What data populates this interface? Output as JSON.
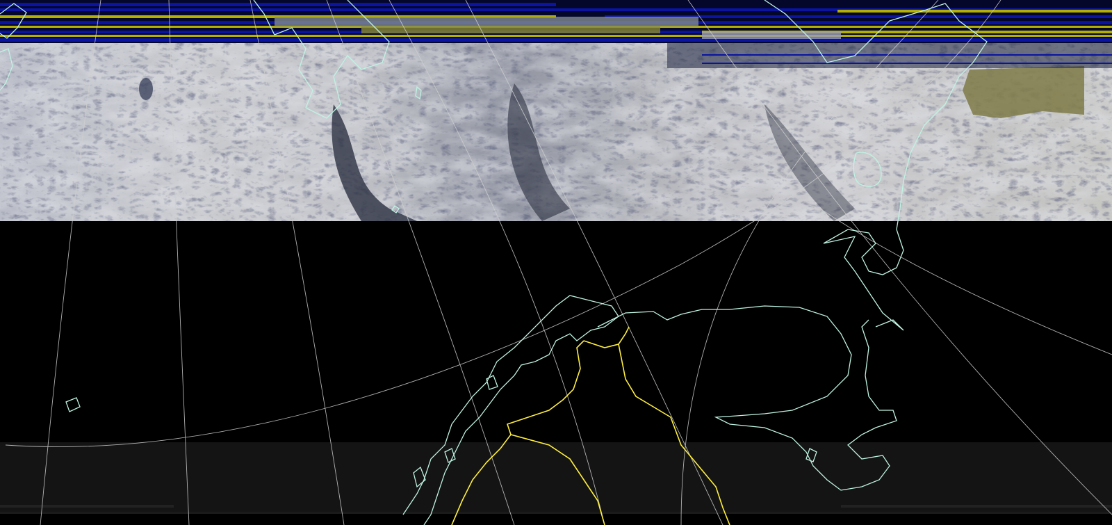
{
  "image": {
    "kind": "satellite weather image with map overlay",
    "text_visible": false
  },
  "colors": {
    "background": "#000000",
    "coastline": "#bff3e3",
    "border": "#ffef40",
    "graticule": "#cfcfcf",
    "cloud_light": "#c7c8cc",
    "cloud_mid": "#9a9ca6",
    "cloud_dark": "#2c2f3d",
    "noise_blue": "#0a14a0",
    "noise_yellow": "#b4b000",
    "land_olive": "#7f7a48"
  },
  "layers": [
    {
      "id": "satellite-imagery",
      "visible": true
    },
    {
      "id": "signal-noise-stripes",
      "visible": true
    },
    {
      "id": "graticule-lines",
      "visible": true
    },
    {
      "id": "coastlines",
      "visible": true
    },
    {
      "id": "country-borders",
      "visible": true
    }
  ]
}
